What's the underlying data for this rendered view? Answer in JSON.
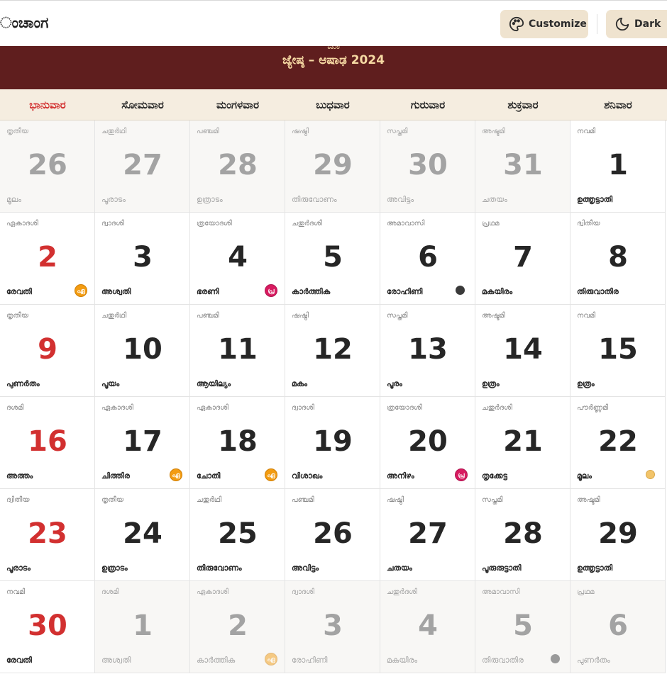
{
  "header": {
    "app_title": "ಂಚಾಂಗ",
    "customize_label": "Customize",
    "dark_label": "Dark"
  },
  "banner": {
    "title": "ಜ್ಯೇಷ್ಠ – ಆಷಾಢ 2024",
    "subtitle": "ಜೂ"
  },
  "weekdays": [
    "ಭಾನುವಾರ",
    "ಸೋಮವಾರ",
    "ಮಂಗಳವಾರ",
    "ಬುಧವಾರ",
    "ಗುರುವಾರ",
    "ಶುಕ್ರವಾರ",
    "ಶನಿವಾರ"
  ],
  "weeks": [
    [
      {
        "tithi": "തൃതീയ",
        "day": "26",
        "nakshatra": "മൂലം",
        "other": true
      },
      {
        "tithi": "ചതുർഥി",
        "day": "27",
        "nakshatra": "പൂരാടം",
        "other": true
      },
      {
        "tithi": "പഞ്ചമി",
        "day": "28",
        "nakshatra": "ഉത്രാടം",
        "other": true
      },
      {
        "tithi": "ഷഷ്ഠി",
        "day": "29",
        "nakshatra": "തിരുവോണം",
        "other": true
      },
      {
        "tithi": "സപ്തമി",
        "day": "30",
        "nakshatra": "അവിട്ടം",
        "other": true
      },
      {
        "tithi": "അഷ്ടമി",
        "day": "31",
        "nakshatra": "ചതയം",
        "other": true
      },
      {
        "tithi": "നവമി",
        "day": "1",
        "nakshatra": "ഉത്തൃട്ടാതി",
        "other": false
      }
    ],
    [
      {
        "tithi": "ഏകാദശി",
        "day": "2",
        "nakshatra": "രേവതി",
        "other": false,
        "badge": "orange",
        "badge_text": "ഏ"
      },
      {
        "tithi": "ദ്വാദശി",
        "day": "3",
        "nakshatra": "അശ്വതി",
        "other": false
      },
      {
        "tithi": "ത്രയോദശി",
        "day": "4",
        "nakshatra": "ഭരണി",
        "other": false,
        "badge": "pink",
        "badge_text": "പ്ര"
      },
      {
        "tithi": "ചതുർദശി",
        "day": "5",
        "nakshatra": "കാർത്തിക",
        "other": false
      },
      {
        "tithi": "അമാവാസി",
        "day": "6",
        "nakshatra": "രോഹിണി",
        "other": false,
        "moon": "new"
      },
      {
        "tithi": "പ്രഥമ",
        "day": "7",
        "nakshatra": "മകയിരം",
        "other": false
      },
      {
        "tithi": "ദ്വിതീയ",
        "day": "8",
        "nakshatra": "തിരുവാതിര",
        "other": false
      }
    ],
    [
      {
        "tithi": "തൃതീയ",
        "day": "9",
        "nakshatra": "പുണർതം",
        "other": false
      },
      {
        "tithi": "ചതുർഥി",
        "day": "10",
        "nakshatra": "പൂയം",
        "other": false
      },
      {
        "tithi": "പഞ്ചമി",
        "day": "11",
        "nakshatra": "ആയില്യം",
        "other": false
      },
      {
        "tithi": "ഷഷ്ഠി",
        "day": "12",
        "nakshatra": "മകം",
        "other": false
      },
      {
        "tithi": "സപ്തമി",
        "day": "13",
        "nakshatra": "പൂരം",
        "other": false
      },
      {
        "tithi": "അഷ്ടമി",
        "day": "14",
        "nakshatra": "ഉത്രം",
        "other": false
      },
      {
        "tithi": "നവമി",
        "day": "15",
        "nakshatra": "ഉത്രം",
        "other": false
      }
    ],
    [
      {
        "tithi": "ദശമി",
        "day": "16",
        "nakshatra": "അത്തം",
        "other": false
      },
      {
        "tithi": "ഏകാദശി",
        "day": "17",
        "nakshatra": "ചിത്തിര",
        "other": false,
        "badge": "orange",
        "badge_text": "ഏ"
      },
      {
        "tithi": "ഏകാദശി",
        "day": "18",
        "nakshatra": "ചോതി",
        "other": false,
        "badge": "orange",
        "badge_text": "ഏ"
      },
      {
        "tithi": "ദ്വാദശി",
        "day": "19",
        "nakshatra": "വിശാഖം",
        "other": false
      },
      {
        "tithi": "ത്രയോദശി",
        "day": "20",
        "nakshatra": "അനിഴം",
        "other": false,
        "badge": "pink",
        "badge_text": "പ്ര"
      },
      {
        "tithi": "ചതുർദശി",
        "day": "21",
        "nakshatra": "തൃക്കേട്ട",
        "other": false
      },
      {
        "tithi": "പൗർണ്ണമി",
        "day": "22",
        "nakshatra": "മൂലം",
        "other": false,
        "moon": "full"
      }
    ],
    [
      {
        "tithi": "ദ്വിതീയ",
        "day": "23",
        "nakshatra": "പൂരാടം",
        "other": false
      },
      {
        "tithi": "തൃതീയ",
        "day": "24",
        "nakshatra": "ഉത്രാടം",
        "other": false
      },
      {
        "tithi": "ചതുർഥി",
        "day": "25",
        "nakshatra": "തിരുവോണം",
        "other": false
      },
      {
        "tithi": "പഞ്ചമി",
        "day": "26",
        "nakshatra": "അവിട്ടം",
        "other": false
      },
      {
        "tithi": "ഷഷ്ഠി",
        "day": "27",
        "nakshatra": "ചതയം",
        "other": false
      },
      {
        "tithi": "സപ്തമി",
        "day": "28",
        "nakshatra": "പൂരുരുട്ടാതി",
        "other": false
      },
      {
        "tithi": "അഷ്ടമി",
        "day": "29",
        "nakshatra": "ഉത്തൃട്ടാതി",
        "other": false
      }
    ],
    [
      {
        "tithi": "നവമി",
        "day": "30",
        "nakshatra": "രേവതി",
        "other": false
      },
      {
        "tithi": "ദശമി",
        "day": "1",
        "nakshatra": "അശ്വതി",
        "other": true
      },
      {
        "tithi": "ഏകാദശി",
        "day": "2",
        "nakshatra": "കാർത്തിക",
        "other": true,
        "badge": "orange",
        "badge_text": "ഏ"
      },
      {
        "tithi": "ദ്വാദശി",
        "day": "3",
        "nakshatra": "രോഹിണി",
        "other": true
      },
      {
        "tithi": "ചതുർദശി",
        "day": "4",
        "nakshatra": "മകയിരം",
        "other": true
      },
      {
        "tithi": "അമാവാസി",
        "day": "5",
        "nakshatra": "തിരുവാതിര",
        "other": true,
        "moon": "new"
      },
      {
        "tithi": "പ്രഥമ",
        "day": "6",
        "nakshatra": "പുണർതം",
        "other": true
      }
    ]
  ]
}
